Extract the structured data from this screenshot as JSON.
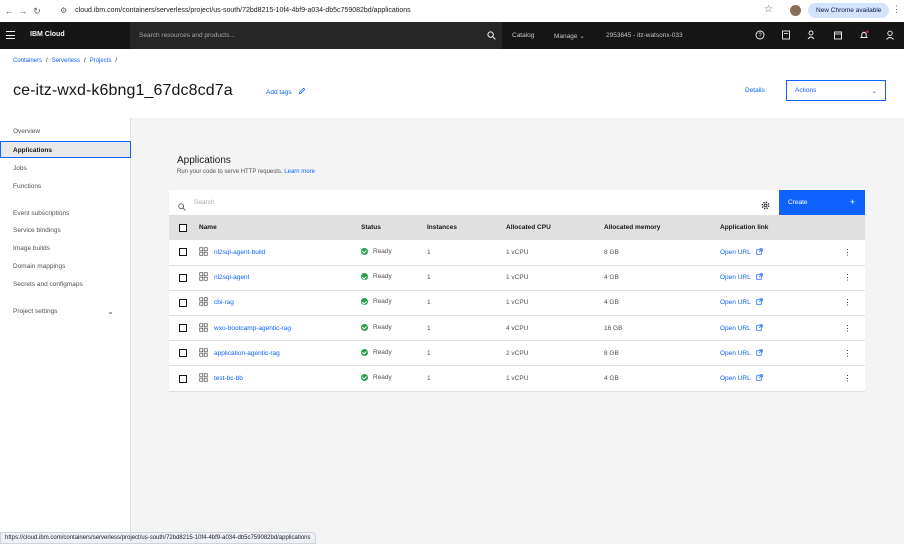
{
  "browser": {
    "url": "cloud.ibm.com/containers/serverless/project/us-south/72bd8215-10f4-4bf9-a034-db5c759082bd/applications",
    "update_label": "New Chrome available",
    "status_url": "https://cloud.ibm.com/containers/serverless/project/us-south/72bd8215-10f4-4bf9-a034-db5c759082bd/applications"
  },
  "header": {
    "brand": "IBM Cloud",
    "search_placeholder": "Search resources and products...",
    "catalog": "Catalog",
    "manage": "Manage",
    "account": "2953645 - itz-watsonx-033"
  },
  "breadcrumb": [
    "Containers",
    "Serverless",
    "Projects"
  ],
  "page": {
    "title": "ce-itz-wxd-k6bng1_67dc8cd7a",
    "add_tags": "Add tags",
    "details": "Details",
    "actions": "Actions"
  },
  "sidebar": {
    "items": [
      {
        "label": "Overview"
      },
      {
        "label": "Applications"
      },
      {
        "label": "Jobs"
      },
      {
        "label": "Functions"
      },
      {
        "label": "Event subscriptions"
      },
      {
        "label": "Service bindings"
      },
      {
        "label": "Image builds"
      },
      {
        "label": "Domain mappings"
      },
      {
        "label": "Secrets and configmaps"
      },
      {
        "label": "Project settings"
      }
    ]
  },
  "main": {
    "title": "Applications",
    "subtitle": "Run your code to serve HTTP requests.",
    "learn_more": "Learn more",
    "search_placeholder": "Search",
    "create_label": "Create",
    "columns": [
      "Name",
      "Status",
      "Instances",
      "Allocated CPU",
      "Allocated memory",
      "Application link"
    ],
    "rows": [
      {
        "name": "nl2sql-agent-build",
        "status": "Ready",
        "instances": "1",
        "cpu": "1 vCPU",
        "memory": "8 GB",
        "link": "Open URL"
      },
      {
        "name": "nl2sql-agent",
        "status": "Ready",
        "instances": "1",
        "cpu": "1 vCPU",
        "memory": "4 GB",
        "link": "Open URL"
      },
      {
        "name": "cbi-rag",
        "status": "Ready",
        "instances": "1",
        "cpu": "1 vCPU",
        "memory": "4 GB",
        "link": "Open URL"
      },
      {
        "name": "wxo-bootcamp-agentic-rag",
        "status": "Ready",
        "instances": "1",
        "cpu": "4 vCPU",
        "memory": "16 GB",
        "link": "Open URL"
      },
      {
        "name": "application-agentic-rag",
        "status": "Ready",
        "instances": "1",
        "cpu": "2 vCPU",
        "memory": "8 GB",
        "link": "Open URL"
      },
      {
        "name": "test-bc-bb",
        "status": "Ready",
        "instances": "1",
        "cpu": "1 vCPU",
        "memory": "4 GB",
        "link": "Open URL"
      }
    ]
  },
  "colors": {
    "accent": "#0f62fe",
    "header_bg": "#161616",
    "ready": "#24a148"
  }
}
